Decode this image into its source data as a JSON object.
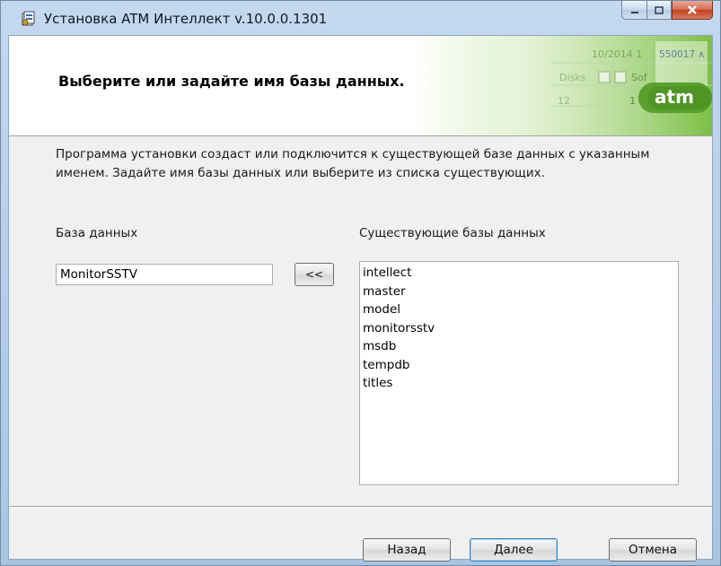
{
  "window": {
    "title": "Установка ATM Интеллект v.10.0.0.1301",
    "icon": "installer-icon"
  },
  "banner": {
    "heading": "Выберите или задайте имя базы данных.",
    "logo_text": "atm",
    "background_fragments": [
      "10/2014 1",
      "550017 ∧",
      "Disks",
      "Sof",
      "12",
      "1"
    ],
    "accent_color": "#5aa02c"
  },
  "description": "Программа установки создаст или подключится к существующей базе данных с указанным именем. Задайте имя базы данных или выберите из списка существующих.",
  "database": {
    "label": "База данных",
    "value": "MonitorSSTV"
  },
  "move_button_label": "<<",
  "existing": {
    "label": "Существующие базы данных",
    "items": [
      "intellect",
      "master",
      "model",
      "monitorsstv",
      "msdb",
      "tempdb",
      "titles"
    ]
  },
  "footer": {
    "back_label": "Назад",
    "next_label": "Далее",
    "cancel_label": "Отмена"
  }
}
